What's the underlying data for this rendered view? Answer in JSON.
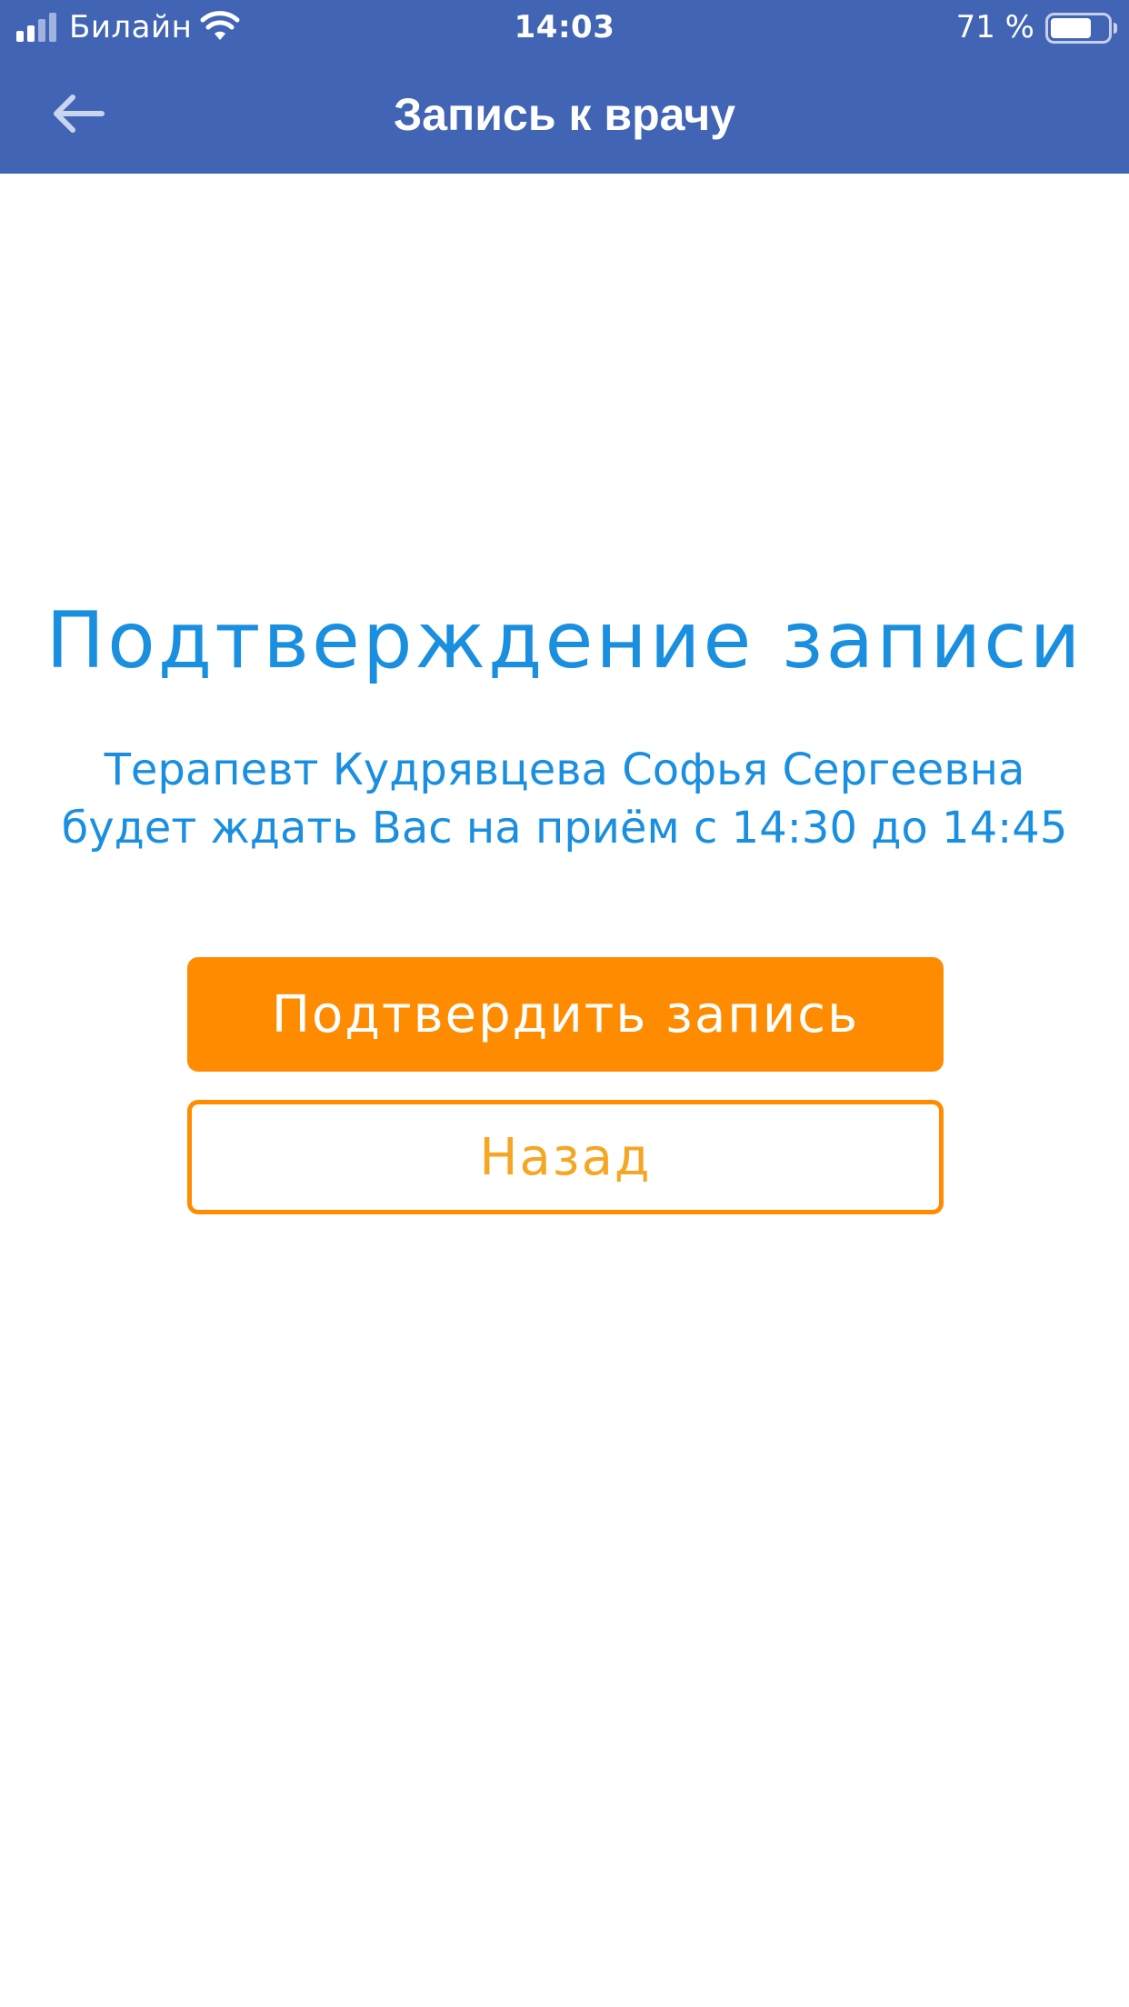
{
  "status_bar": {
    "carrier": "Билайн",
    "time": "14:03",
    "battery_percent": "71 %",
    "battery_level": 0.71
  },
  "nav_bar": {
    "title": "Запись к врачу",
    "back_icon": "arrow-left-icon"
  },
  "confirmation": {
    "heading": "Подтверждение записи",
    "message": "Терапевт Кудрявцева Софья Сергеевна будет ждать Вас на приём с 14:30 до 14:45"
  },
  "buttons": {
    "confirm_label": "Подтвердить запись",
    "back_label": "Назад"
  },
  "colors": {
    "nav_background": "#4264b5",
    "accent_blue": "#1a8fe0",
    "accent_orange": "#ff8c00"
  }
}
